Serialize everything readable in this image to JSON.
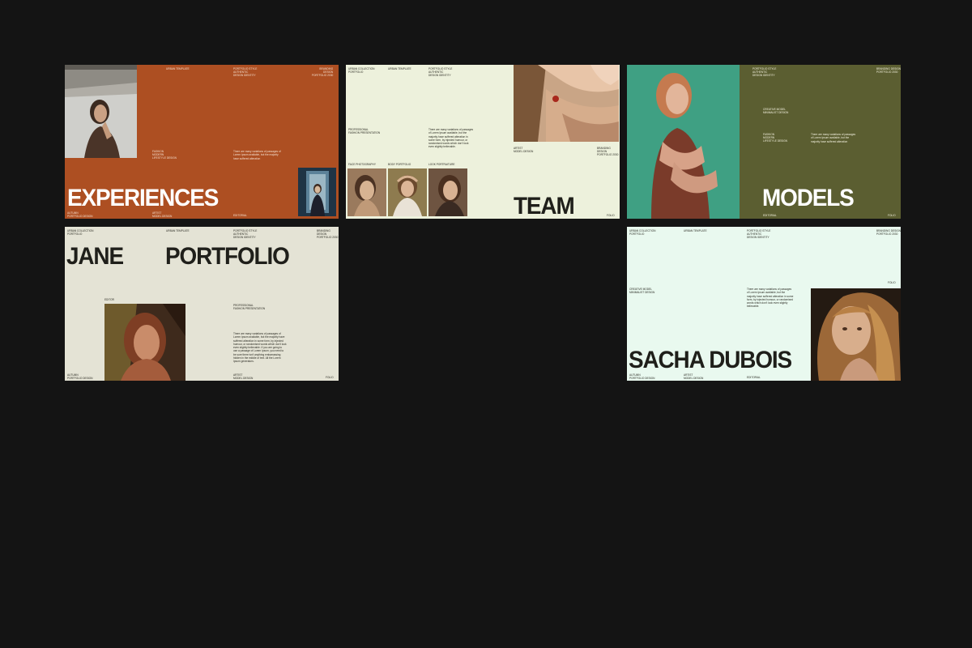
{
  "colors": {
    "background": "#141414",
    "rust": "#ad4f22",
    "cream": "#edf1dc",
    "olive": "#5b5e31",
    "beige": "#e4e3d5",
    "mint": "#e9f9ef"
  },
  "slides": {
    "experiences": {
      "title": "EXPERIENCES",
      "top_left": "URBAN TEMPLATE",
      "top_mid": "PORTFOLIO STYLE\nAUTHENTIC\nDESIGN IDENTITY",
      "top_right": "BRANDING DESIGN\nPORTFOLIO 2030",
      "mid_labels": "FASHION\nMODERN\nLIFESTYLE DESIGN",
      "body": "There are many variations of passages of Lorem Ipsum available, but the majority have suffered alteration",
      "foot_1": "AUTUMN\nPORTFOLIO DESIGN",
      "foot_2": "ARTIST\nMODEL DESIGN",
      "foot_3": "EDITORIAL"
    },
    "team": {
      "title": "TEAM",
      "top_1": "URBAN COLLECTION\nPORTFOLIO",
      "top_2": "URBAN TEMPLATE",
      "top_3": "PORTFOLIO STYLE\nAUTHENTIC\nDESIGN IDENTITY",
      "side_label": "PROFESSIONAL\nFASHION PRESENTATION",
      "body": "There are many variations of passages of Lorem Ipsum available, but the majority have suffered alteration in some form, by injected humour, or randomised words which don't look even slightly believable.",
      "mid_1": "ARTIST\nMODEL DESIGN",
      "mid_2": "BRANDING DESIGN\nPORTFOLIO 2030",
      "cap_1": "FACE PHOTOGRAPHY",
      "cap_2": "BODY PORTFOLIO",
      "cap_3": "LOOK PORTRAITURE",
      "foot": "FOLIO"
    },
    "models": {
      "title": "MODELS",
      "top_1": "PORTFOLIO STYLE\nAUTHENTIC\nDESIGN IDENTITY",
      "top_2": "BRANDING DESIGN\nPORTFOLIO 2030",
      "label_1": "CREATIVE MODEL\nMINIMALIST DESIGN",
      "label_2": "FASHION\nMODERN\nLIFESTYLE DESIGN",
      "body": "There are many variations of passages of Lorem Ipsum available, but the majority have suffered alteration",
      "foot_1": "EDITORIAL",
      "foot_2": "FOLIO"
    },
    "jane": {
      "title_1": "JANE",
      "title_2": "PORTFOLIO",
      "top_1": "URBAN COLLECTION\nPORTFOLIO",
      "top_2": "URBAN TEMPLATE",
      "top_3": "PORTFOLIO STYLE\nAUTHENTIC\nDESIGN IDENTITY",
      "top_4": "BRANDING DESIGN\nPORTFOLIO 2030",
      "photo_label": "EDITOR",
      "side_label": "PROFESSIONAL\nFASHION PRESENTATION",
      "body": "There are many variations of passages of Lorem Ipsum available, but the majority have suffered alteration in some form, by injected humour, or randomised words which don't look even slightly believable. If you are going to use a passage of Lorem Ipsum, you need to be sure there isn't anything embarrassing hidden in the middle of text. All the Lorem Ipsum generators.",
      "foot_1": "AUTUMN\nPORTFOLIO DESIGN",
      "foot_2": "ARTIST\nMODEL DESIGN",
      "foot_3": "FOLIO"
    },
    "sacha": {
      "title": "SACHA DUBOIS",
      "top_1": "URBAN COLLECTION\nPORTFOLIO",
      "top_2": "URBAN TEMPLATE",
      "top_3": "PORTFOLIO STYLE\nAUTHENTIC\nDESIGN IDENTITY",
      "top_4": "BRANDING DESIGN\nPORTFOLIO 2030",
      "side_label": "CREATIVE MODEL\nMINIMALIST DESIGN",
      "body": "There are many variations of passages of Lorem Ipsum available, but the majority have suffered alteration in some form, by injected humour, or randomised words which don't look even slightly believable.",
      "page_label": "FOLIO",
      "foot_1": "AUTUMN\nPORTFOLIO DESIGN",
      "foot_2": "ARTIST\nMODEL DESIGN",
      "foot_3": "EDITORIAL"
    }
  }
}
